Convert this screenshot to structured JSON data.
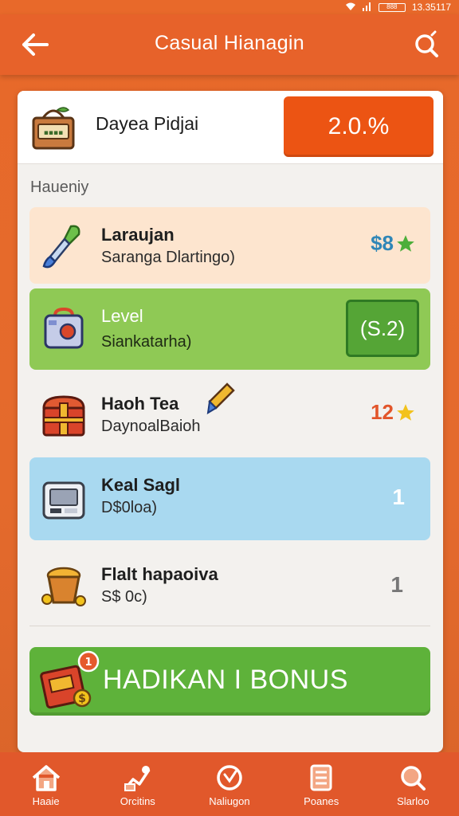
{
  "status": {
    "time": "13.35117",
    "battery": "888"
  },
  "header": {
    "title": "Casual Hianagin"
  },
  "profile": {
    "name": "Dayea Pidjai",
    "badge": "2.0.%"
  },
  "section": {
    "label": "Haueniy"
  },
  "rows": [
    {
      "title": "Laraujan",
      "subtitle": "Saranga Dlartingo)",
      "value": "$8",
      "icon": "paintbrush-icon",
      "value_icon": "star-icon"
    },
    {
      "title": "Level",
      "subtitle": "Siankatarha)",
      "value": "(S.2)",
      "icon": "toolbox-icon"
    },
    {
      "title": "Haoh Tea",
      "subtitle": "DaynoalBaioh",
      "value": "12",
      "icon": "treasure-chest-icon",
      "value_icon": "star-icon"
    },
    {
      "title": "Keal Sagl",
      "subtitle": "D$0loa)",
      "value": "1",
      "icon": "machine-icon"
    },
    {
      "title": "Flalt hapaoiva",
      "subtitle": "S$ 0c)",
      "value": "1",
      "icon": "coin-basket-icon"
    }
  ],
  "bonus": {
    "label": "HADIKAN I BONUS",
    "badge": "1"
  },
  "nav": [
    {
      "label": "Haaie",
      "icon": "home-icon"
    },
    {
      "label": "Orcitins",
      "icon": "chart-icon"
    },
    {
      "label": "Naliugon",
      "icon": "compass-icon"
    },
    {
      "label": "Poanes",
      "icon": "list-icon"
    },
    {
      "label": "Slarloo",
      "icon": "search-icon"
    }
  ],
  "colors": {
    "primary": "#e7622a",
    "accent": "#ec5413",
    "green": "#5eb23a",
    "light_green": "#8fc955",
    "blue": "#a9d9f0",
    "peach": "#fde5cf"
  }
}
